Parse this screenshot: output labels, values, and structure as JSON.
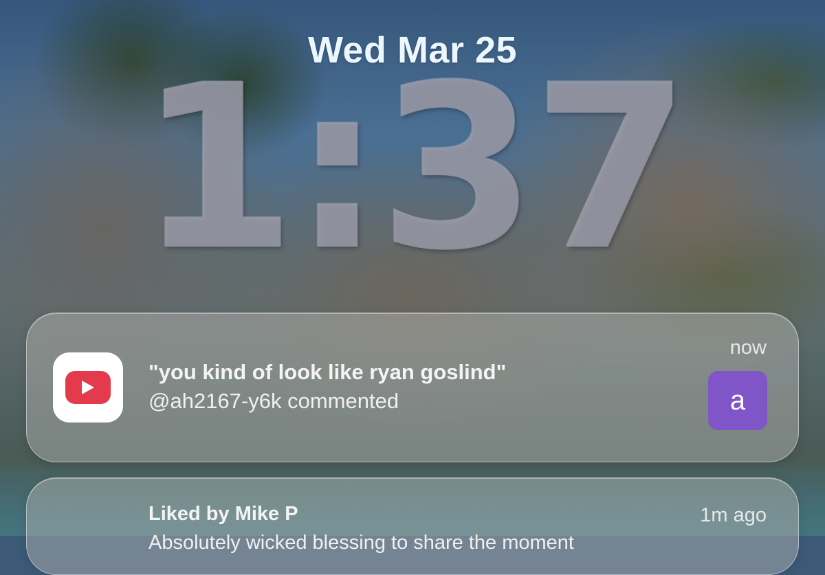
{
  "lockscreen": {
    "date": "Wed Mar 25",
    "time": "1:37"
  },
  "notifications": [
    {
      "app_icon": "youtube-play-icon",
      "title": "\"you kind of look like ryan goslind\"",
      "body": "@ah2167-y6k commented",
      "time": "now",
      "avatar_letter": "a",
      "avatar_color": "#7f55c7"
    },
    {
      "title": "Liked by Mike P",
      "time": "1m ago",
      "body": "Absolutely wicked blessing to share the moment"
    }
  ],
  "colors": {
    "youtube_red": "#e33b4b",
    "notification_text": "#f4f4f4",
    "date_text": "#ecf6ff"
  }
}
